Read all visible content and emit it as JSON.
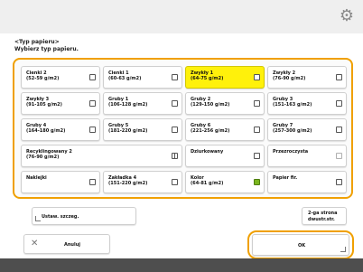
{
  "header": {
    "title": "<Typ papieru>",
    "subtitle": "Wybierz typ papieru."
  },
  "grid": [
    {
      "name": "paper-type-cienki-2",
      "lines": [
        "Cienki 2",
        "(52-59 g/m2)"
      ],
      "icon": "paper-icon",
      "selected": false
    },
    {
      "name": "paper-type-cienki-1",
      "lines": [
        "Cienki 1",
        "(60-63 g/m2)"
      ],
      "icon": "paper-icon",
      "selected": false
    },
    {
      "name": "paper-type-zwykly-1",
      "lines": [
        "Zwykły 1",
        "(64-75 g/m2)"
      ],
      "icon": "paper-icon",
      "selected": true
    },
    {
      "name": "paper-type-zwykly-2",
      "lines": [
        "Zwykły 2",
        "(76-90 g/m2)"
      ],
      "icon": "paper-icon",
      "selected": false
    },
    {
      "name": "paper-type-zwykly-3",
      "lines": [
        "Zwykły 3",
        "(91-105 g/m2)"
      ],
      "icon": "paper-icon",
      "selected": false
    },
    {
      "name": "paper-type-gruby-1",
      "lines": [
        "Gruby 1",
        "(106-128 g/m2)"
      ],
      "icon": "paper-icon",
      "selected": false
    },
    {
      "name": "paper-type-gruby-2",
      "lines": [
        "Gruby 2",
        "(129-150 g/m2)"
      ],
      "icon": "paper-icon",
      "selected": false
    },
    {
      "name": "paper-type-gruby-3",
      "lines": [
        "Gruby 3",
        "(151-163 g/m2)"
      ],
      "icon": "paper-icon",
      "selected": false
    },
    {
      "name": "paper-type-gruby-4",
      "lines": [
        "Gruby 4",
        "(164-180 g/m2)"
      ],
      "icon": "paper-icon",
      "selected": false
    },
    {
      "name": "paper-type-gruby-5",
      "lines": [
        "Gruby 5",
        "(181-220 g/m2)"
      ],
      "icon": "paper-icon",
      "selected": false
    },
    {
      "name": "paper-type-gruby-6",
      "lines": [
        "Gruby 6",
        "(221-256 g/m2)"
      ],
      "icon": "paper-icon",
      "selected": false
    },
    {
      "name": "paper-type-gruby-7",
      "lines": [
        "Gruby 7",
        "(257-300 g/m2)"
      ],
      "icon": "paper-icon",
      "selected": false
    },
    {
      "name": "paper-type-recyklingowany-2",
      "lines": [
        "Recyklingowany 2",
        "(76-90 g/m2)"
      ],
      "icon": "grid-icon",
      "selected": false,
      "span": 2
    },
    {
      "name": "paper-type-dziurkowany",
      "lines": [
        "Dziurkowany"
      ],
      "icon": "paper-icon",
      "selected": false
    },
    {
      "name": "paper-type-przezroczysta",
      "lines": [
        "Przezroczysta"
      ],
      "icon": "ghost-icon",
      "selected": false
    },
    {
      "name": "paper-type-naklejki",
      "lines": [
        "Naklejki"
      ],
      "icon": "label-icon",
      "selected": false
    },
    {
      "name": "paper-type-zakladka-4",
      "lines": [
        "Zakładka 4",
        "(151-220 g/m2)"
      ],
      "icon": "paper-icon",
      "selected": false
    },
    {
      "name": "paper-type-kolor",
      "lines": [
        "Kolor",
        "(64-81 g/m2)"
      ],
      "icon": "color-icon",
      "selected": false
    },
    {
      "name": "paper-type-papier-firmowy",
      "lines": [
        "Papier fir."
      ],
      "icon": "paper-icon",
      "selected": false
    }
  ],
  "buttons": {
    "advanced_label": "Ustaw. szczeg.",
    "two_sided_label_1": "2-ga strona",
    "two_sided_label_2": "dwustr.str.",
    "cancel_label": "Anuluj",
    "ok_label": "OK"
  },
  "colors": {
    "selected": "#fff10b",
    "accent_ring": "#f0a000",
    "footer": "#4e4e4e"
  }
}
